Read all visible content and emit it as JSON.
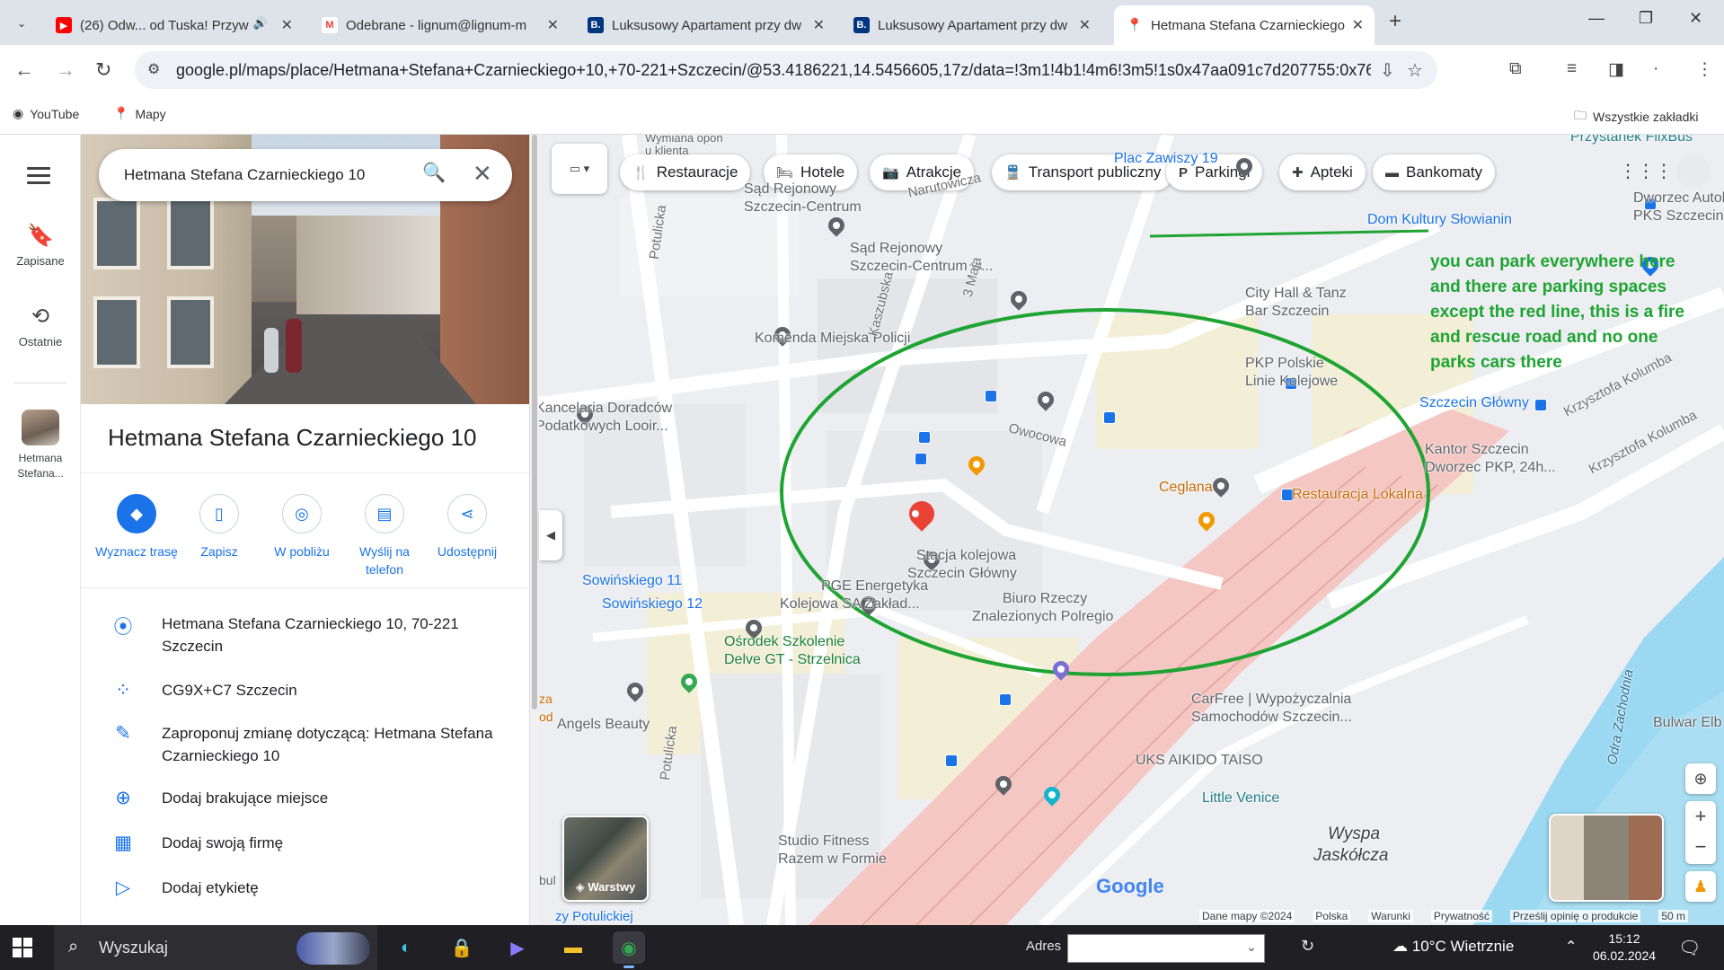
{
  "browser": {
    "tabs": [
      {
        "title": "(26) Odw... od Tuska! Przyw",
        "favicon": "youtube-icon",
        "color": "#ff0000"
      },
      {
        "title": "Odebrane - lignum@lignum-m",
        "favicon": "gmail-icon",
        "color": "#ea4335"
      },
      {
        "title": "Luksusowy Apartament przy dw",
        "favicon": "booking-icon",
        "color": "#003580",
        "glyph": "B."
      },
      {
        "title": "Luksusowy Apartament przy dw",
        "favicon": "booking-icon",
        "color": "#003580",
        "glyph": "B."
      },
      {
        "title": "Hetmana Stefana Czarnieckiego",
        "favicon": "maps-pin-icon",
        "color": "#34a853"
      }
    ],
    "url": "google.pl/maps/place/Hetmana+Stefana+Czarnieckiego+10,+70-221+Szczecin/@53.4186221,14.5456605,17z/data=!3m1!4b1!4m6!3m5!1s0x47aa091c7d207755:0x7650cb41b3...",
    "bookmarks": [
      {
        "label": "YouTube",
        "icon": "youtube-icon"
      },
      {
        "label": "Mapy",
        "icon": "maps-pin-icon"
      }
    ],
    "all_bookmarks": "Wszystkie zakładki"
  },
  "rail": {
    "saved": "Zapisane",
    "recent": "Ostatnie",
    "recent_place": "Hetmana Stefana..."
  },
  "panel": {
    "search_value": "Hetmana Stefana Czarnieckiego 10",
    "title": "Hetmana Stefana Czarnieckiego 10",
    "actions": [
      {
        "label": "Wyznacz trasę",
        "icon": "directions-icon"
      },
      {
        "label": "Zapisz",
        "icon": "bookmark-icon"
      },
      {
        "label": "W pobliżu",
        "icon": "nearby-icon"
      },
      {
        "label": "Wyślij na telefon",
        "icon": "send-to-phone-icon"
      },
      {
        "label": "Udostępnij",
        "icon": "share-icon"
      }
    ],
    "info": [
      {
        "text": "Hetmana Stefana Czarnieckiego 10, 70-221 Szczecin",
        "icon": "location-pin-icon"
      },
      {
        "text": "CG9X+C7 Szczecin",
        "icon": "plus-code-icon"
      },
      {
        "text": "Zaproponuj zmianę dotyczącą: Hetmana Stefana Czarnieckiego 10",
        "icon": "pencil-icon"
      },
      {
        "text": "Dodaj brakujące miejsce",
        "icon": "add-place-icon"
      },
      {
        "text": "Dodaj swoją firmę",
        "icon": "add-business-icon"
      },
      {
        "text": "Dodaj etykietę",
        "icon": "label-icon"
      }
    ]
  },
  "map": {
    "chips": [
      {
        "label": "Restauracje",
        "icon": "restaurant-icon"
      },
      {
        "label": "Hotele",
        "icon": "hotel-icon"
      },
      {
        "label": "Atrakcje",
        "icon": "camera-icon"
      },
      {
        "label": "Transport publiczny",
        "icon": "transit-icon"
      },
      {
        "label": "Parkingi",
        "icon": "parking-icon"
      },
      {
        "label": "Apteki",
        "icon": "pharmacy-icon"
      },
      {
        "label": "Bankomaty",
        "icon": "atm-icon"
      }
    ],
    "labels": {
      "wymiana": "Wymiana opon",
      "u_klienta": "u klienta",
      "plac": "Plac Zawiszy 19",
      "przystanek": "Przystanek FlixBus",
      "dworzec_autob": "Dworzec Autob",
      "pks": "PKS Szczecin",
      "sad_rej": "Sąd Rejonowy",
      "szcz_centrum": "Szczecin-Centrum",
      "narutowicza": "Narutowicza",
      "sad_rej2": "Sąd Rejonowy",
      "sad_rej2b": "Szczecin-Centrum w...",
      "dom_kultury": "Dom Kultury Słowianin",
      "city_hall": "City Hall & Tanz",
      "city_hall2": "Bar Szczecin",
      "komenda": "Komenda Miejska Policji",
      "pkp": "PKP Polskie",
      "pkp2": "Linie Kolejowe",
      "szcz_glowny": "Szczecin Główny",
      "kancelaria": "Kancelaria Doradców",
      "kancelaria2": "Podatkowych Looir...",
      "owocowa": "Owocowa",
      "ceglana": "Ceglana",
      "kantor": "Kantor Szczecin",
      "kantor2": "Dworzec PKP, 24h...",
      "restauracja": "Restauracja Lokalna",
      "stacja": "Stacja kolejowa",
      "stacja2": "Szczecin Główny",
      "sowin11": "Sowińskiego 11",
      "sowin12": "Sowińskiego 12",
      "pge": "PGE Energetyka",
      "pge2": "Kolejowa SA Zakład...",
      "biuro": "Biuro Rzeczy",
      "biuro2": "Znalezionych Polregio",
      "osrodek": "Ośrodek Szkolenie",
      "osrodek2": "Delve GT - Strzelnica",
      "angels": "Angels Beauty",
      "carfree": "CarFree | Wypożyczalnia",
      "carfree2": "Samochodów Szczecin...",
      "bulwar": "Bulwar Elb",
      "uks": "UKS AIKIDO TAISO",
      "little_venice": "Little Venice",
      "wyspa": "Wyspa",
      "jaskolcza": "Jaskółcza",
      "studio": "Studio Fitness",
      "studio2": "Razem w Formie",
      "potulicka": "Potulicka",
      "potulicka2": "Potulicka",
      "kaszubska": "Kaszubska",
      "maja": "3 Maja",
      "kolumba": "Krzysztofa Kolumba",
      "kolumba2": "Krzysztofa Kolumba",
      "odra": "Odra Zachodnia",
      "zy_potulickiej": "zy Potulickiej",
      "za": "za",
      "od": "od",
      "bul": "bul"
    },
    "annotation": "you can park everywhere here and there are parking spaces except the red line, this is a fire and rescue road and no one parks cars there",
    "layers_label": "Warstwy",
    "google": "Google",
    "footer": [
      "Dane mapy ©2024",
      "Polska",
      "Warunki",
      "Prywatność",
      "Prześlij opinię o produkcie",
      "50 m"
    ],
    "annotation_color": "#1ea432",
    "marker_color": "#ea4335"
  },
  "taskbar": {
    "search": "Wyszukaj",
    "adres": "Adres",
    "weather": "10°C  Wietrznie",
    "time": "15:12",
    "date": "06.02.2024"
  }
}
